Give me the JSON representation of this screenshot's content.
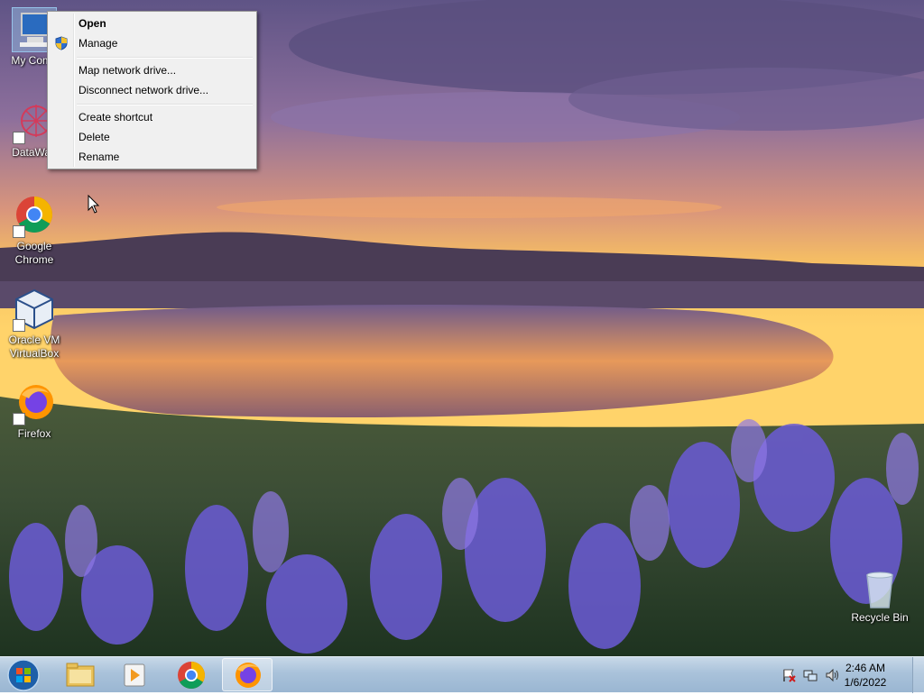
{
  "desktop": {
    "icons": [
      {
        "label": "My Comp"
      },
      {
        "label": "DataWag"
      },
      {
        "label": "Google Chrome"
      },
      {
        "label": "Oracle VM VirtualBox"
      },
      {
        "label": "Firefox"
      },
      {
        "label": "Recycle Bin"
      }
    ]
  },
  "context_menu": {
    "items": [
      {
        "label": "Open",
        "bold": true
      },
      {
        "label": "Manage",
        "icon": "shield-icon"
      },
      {
        "label": "Map network drive..."
      },
      {
        "label": "Disconnect network drive..."
      },
      {
        "label": "Create shortcut"
      },
      {
        "label": "Delete"
      },
      {
        "label": "Rename"
      }
    ]
  },
  "taskbar": {
    "pinned": [
      {
        "icon": "folder-icon",
        "name": "windows-explorer"
      },
      {
        "icon": "media-player-icon",
        "name": "media-player"
      },
      {
        "icon": "chrome-icon",
        "name": "google-chrome"
      },
      {
        "icon": "firefox-icon",
        "name": "firefox",
        "active": true
      }
    ],
    "tray": {
      "icons": [
        "action-center-flag-icon",
        "network-icon",
        "volume-icon"
      ],
      "time": "2:46 AM",
      "date": "1/6/2022"
    }
  },
  "colors": {
    "menu_bg": "#f0f0f0",
    "taskbar": "#a9c2da",
    "sky_top": "#6b5c8e",
    "sunset": "#f4b45a"
  }
}
